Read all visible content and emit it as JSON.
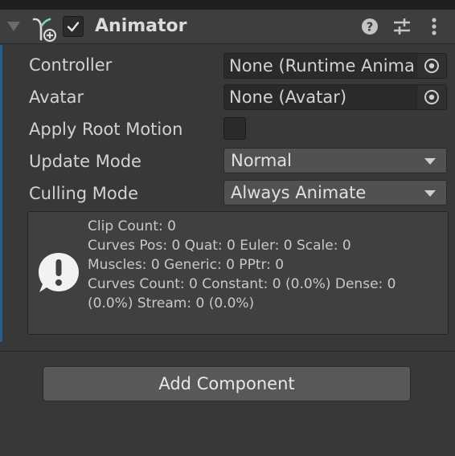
{
  "component": {
    "title": "Animator",
    "icon": "animator-component-icon",
    "enabled": true,
    "header_buttons": [
      "help-icon",
      "presets-icon",
      "more-vert-icon"
    ]
  },
  "properties": {
    "controller": {
      "label": "Controller",
      "value": "None (Runtime Animator Controller)"
    },
    "avatar": {
      "label": "Avatar",
      "value": "None (Avatar)"
    },
    "apply_root_motion": {
      "label": "Apply Root Motion",
      "checked": false
    },
    "update_mode": {
      "label": "Update Mode",
      "value": "Normal"
    },
    "culling_mode": {
      "label": "Culling Mode",
      "value": "Always Animate"
    }
  },
  "info": {
    "icon": "info-exclamation-icon",
    "lines": [
      "Clip Count: 0",
      "Curves Pos: 0 Quat: 0 Euler: 0 Scale: 0",
      "Muscles: 0 Generic: 0 PPtr: 0",
      "Curves Count: 0 Constant: 0 (0.0%) Dense: 0",
      "(0.0%) Stream: 0 (0.0%)"
    ]
  },
  "add_component": {
    "label": "Add Component"
  },
  "colors": {
    "panel_bg": "#383838",
    "header_bg": "#3e3e3e",
    "field_bg": "#2a2a2a",
    "dropdown_bg": "#515151",
    "accent_teal": "#7fd6c2",
    "selection_line": "#2c5d87"
  }
}
